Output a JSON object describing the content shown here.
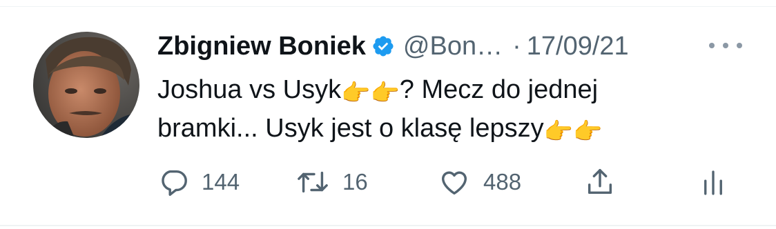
{
  "author": {
    "display_name": "Zbigniew Boniek",
    "handle": "@Bon…",
    "verified": true
  },
  "meta": {
    "separator": "·",
    "date": "17/09/21"
  },
  "tweet": {
    "line1_text": "Joshua vs Usyk",
    "line1_after": "? Mecz do jednej",
    "line2_text": "bramki... Usyk jest o klasę lepszy",
    "emoji": "👉"
  },
  "stats": {
    "replies": "144",
    "retweets": "16",
    "likes": "488"
  },
  "colors": {
    "verified": "#1d9bf0",
    "secondary_text": "#536471",
    "text": "#0f1419"
  },
  "icons": [
    "verified-badge-icon",
    "more-icon",
    "reply-icon",
    "retweet-icon",
    "like-icon",
    "share-icon",
    "analytics-icon"
  ]
}
